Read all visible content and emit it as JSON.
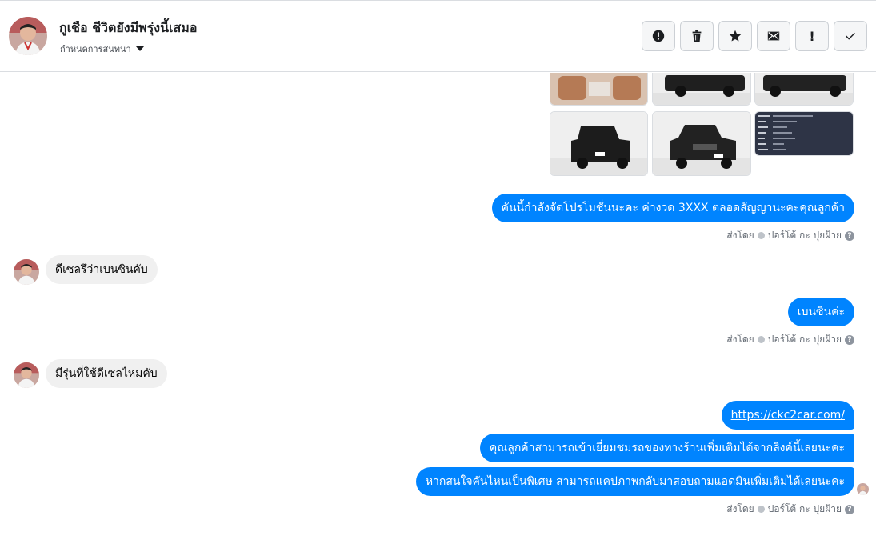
{
  "header": {
    "contact_name": "กูเชือ ชีวิตยังมีพรุ่งนี้เสมอ",
    "contact_subtitle": "กำหนดการสนทนา",
    "actions": [
      {
        "name": "report-button",
        "icon": "alert-circle-icon"
      },
      {
        "name": "delete-button",
        "icon": "trash-icon"
      },
      {
        "name": "star-button",
        "icon": "star-icon"
      },
      {
        "name": "mark-unread-button",
        "icon": "envelope-icon"
      },
      {
        "name": "important-button",
        "icon": "exclamation-icon",
        "glyph": "!"
      },
      {
        "name": "done-button",
        "icon": "check-icon"
      }
    ]
  },
  "messages": {
    "promo": "คันนี้กำลังจัดโปรโมชั่นนะคะ ค่างวด 3XXX ตลอดสัญญานะคะคุณลูกค้า",
    "q_diesel": "ดีเซลรึว่าเบนซินคับ",
    "a_benzin": "เบนซินค่ะ",
    "q_diesel_model": "มีรุ่นที่ใช้ดีเซลไหมคับ",
    "link": "https://ckc2car.com/",
    "visit_site": "คุณลูกค้าสามารถเข้าเยี่ยมชมรถของทางร้านเพิ่มเติมได้จากลิงค์นี้เลยนะคะ",
    "capture_info": "หากสนใจคันไหนเป็นพิเศษ สามารถแคปภาพกลับมาสอบถามแอดมินเพิ่มเติมได้เลยนะคะ"
  },
  "sent_by": {
    "prefix": "ส่งโดย",
    "agent": "ปอร์โต้ กะ ปุยฝ้าย",
    "help": "?"
  },
  "colors": {
    "accent": "#0084ff",
    "incoming_bubble": "#f0f0f0",
    "border": "#dadde1"
  }
}
